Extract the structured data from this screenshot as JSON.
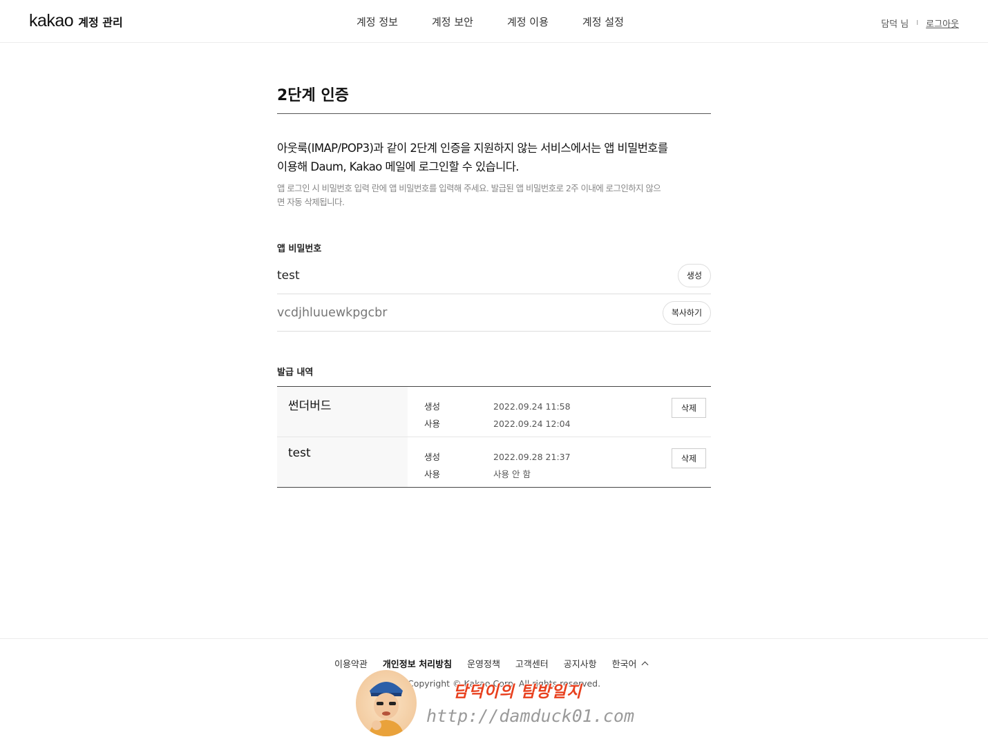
{
  "header": {
    "logo_word": "kakao",
    "logo_sub": "계정 관리",
    "nav": [
      "계정 정보",
      "계정 보안",
      "계정 이용",
      "계정 설정"
    ],
    "user_name": "담덕 님",
    "separator": "I",
    "logout": "로그아웃"
  },
  "page": {
    "title": "2단계 인증",
    "desc_line1": "아웃룩(IMAP/POP3)과 같이 2단계 인증을 지원하지 않는 서비스에서는 앱 비밀번호를",
    "desc_line2": "이용해 Daum, Kakao 메일에 로그인할 수 있습니다.",
    "note_line1": "앱 로그인 시 비밀번호 입력 란에 앱 비밀번호를 입력해 주세요. 발급된 앱 비밀번호로 2주 이내에 로그인하지 않으",
    "note_line2": "면 자동 삭제됩니다."
  },
  "app_password": {
    "label": "앱 비밀번호",
    "name_value": "test",
    "create_button": "생성",
    "generated_value": "vcdjhluuewkpgcbr",
    "copy_button": "복사하기"
  },
  "history": {
    "label": "발급 내역",
    "rows": [
      {
        "name": "썬더버드",
        "created_label": "생성",
        "created": "2022.09.24 11:58",
        "used_label": "사용",
        "used": "2022.09.24 12:04",
        "delete": "삭제"
      },
      {
        "name": "test",
        "created_label": "생성",
        "created": "2022.09.28 21:37",
        "used_label": "사용",
        "used": "사용 안 함",
        "delete": "삭제"
      }
    ]
  },
  "footer": {
    "links": [
      "이용약관",
      "개인정보 처리방침",
      "운영정책",
      "고객센터",
      "공지사항"
    ],
    "language": "한국어",
    "copyright": "Copyright © Kakao Corp. All rights reserved."
  },
  "watermark": {
    "title": "담덕이의 탐방일지",
    "url": "http://damduck01.com"
  }
}
